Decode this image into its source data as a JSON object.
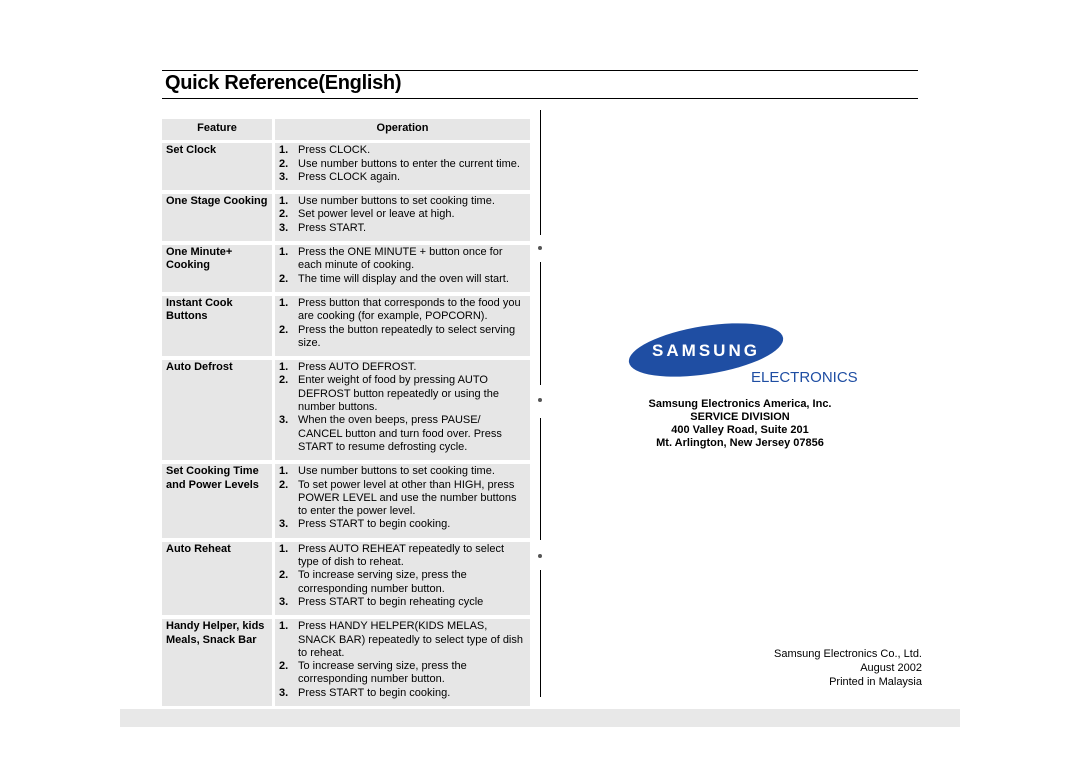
{
  "title": "Quick Reference(English)",
  "table": {
    "headers": {
      "feature": "Feature",
      "operation": "Operation"
    },
    "rows": [
      {
        "feature": "Set Clock",
        "steps": [
          {
            "n": "1.",
            "t": "Press CLOCK."
          },
          {
            "n": "2.",
            "t": "Use number buttons to enter the current time."
          },
          {
            "n": "3.",
            "t": "Press CLOCK again."
          }
        ]
      },
      {
        "feature": "One Stage Cooking",
        "steps": [
          {
            "n": "1.",
            "t": "Use number buttons to set cooking time."
          },
          {
            "n": "2.",
            "t": "Set power level or leave at high."
          },
          {
            "n": "3.",
            "t": "Press START."
          }
        ]
      },
      {
        "feature": "One Minute+ Cooking",
        "steps": [
          {
            "n": "1.",
            "t": "Press the ONE MINUTE + button once for each minute of cooking."
          },
          {
            "n": "2.",
            "t": "The time will display and the oven will start."
          }
        ]
      },
      {
        "feature": "Instant Cook Buttons",
        "steps": [
          {
            "n": "1.",
            "t": "Press button that corresponds to the food you are cooking (for example, POPCORN)."
          },
          {
            "n": "2.",
            "t": "Press the button repeatedly to select serving size."
          }
        ]
      },
      {
        "feature": "Auto Defrost",
        "steps": [
          {
            "n": "1.",
            "t": "Press AUTO DEFROST."
          },
          {
            "n": "2.",
            "t": "Enter weight of food by pressing AUTO DEFROST button repeatedly or using the number buttons."
          },
          {
            "n": "3.",
            "t": "When the oven beeps, press PAUSE/ CANCEL button and turn food over. Press START to resume defrosting cycle."
          }
        ]
      },
      {
        "feature": "Set Cooking Time and Power Levels",
        "steps": [
          {
            "n": "1.",
            "t": "Use number buttons to set cooking time."
          },
          {
            "n": "2.",
            "t": "To set power level at other than HIGH, press POWER LEVEL and use the number buttons to enter the power level."
          },
          {
            "n": "3.",
            "t": "Press START to begin cooking."
          }
        ]
      },
      {
        "feature": "Auto Reheat",
        "steps": [
          {
            "n": "1.",
            "t": "Press AUTO REHEAT repeatedly to select type of dish to reheat."
          },
          {
            "n": "2.",
            "t": "To increase serving size, press the corresponding number button."
          },
          {
            "n": "3.",
            "t": "Press START to begin reheating cycle"
          }
        ]
      },
      {
        "feature": "Handy Helper, kids Meals, Snack Bar",
        "steps": [
          {
            "n": "1.",
            "t": "Press HANDY HELPER(KIDS MELAS, SNACK BAR) repeatedly to select type of dish to reheat."
          },
          {
            "n": "2.",
            "t": "To increase serving size, press the corresponding number button."
          },
          {
            "n": "3.",
            "t": "Press START to begin cooking."
          }
        ]
      }
    ]
  },
  "logo": {
    "brand": "SAMSUNG",
    "sub": "ELECTRONICS",
    "color": "#1f4ea3"
  },
  "address": [
    "Samsung Electronics America, Inc.",
    "SERVICE DIVISION",
    "400 Valley Road, Suite 201",
    "Mt. Arlington, New Jersey 07856"
  ],
  "footer": [
    "Samsung Electronics Co., Ltd.",
    "August  2002",
    "Printed in Malaysia"
  ]
}
